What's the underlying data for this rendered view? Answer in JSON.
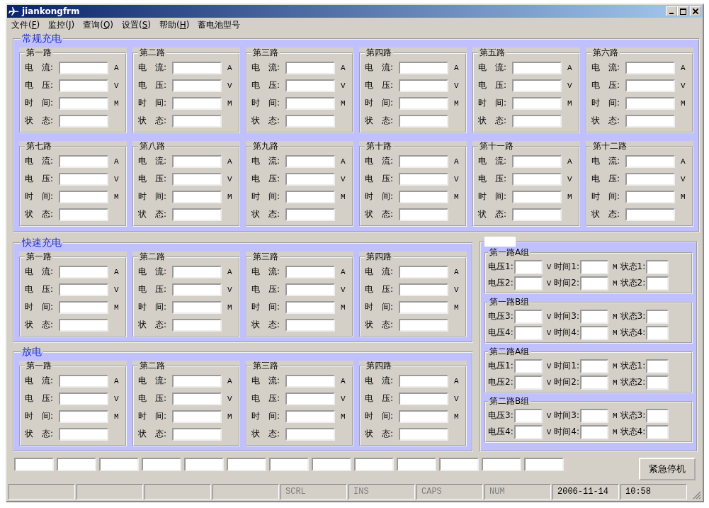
{
  "window": {
    "title": "jiankongfrm"
  },
  "menu": [
    {
      "before": "文件(",
      "key": "F",
      "after": ")"
    },
    {
      "before": "监控(",
      "key": "J",
      "after": ")"
    },
    {
      "before": "查询(",
      "key": "Q",
      "after": ")"
    },
    {
      "before": "设置(",
      "key": "S",
      "after": ")"
    },
    {
      "before": "帮助(",
      "key": "H",
      "after": ")"
    },
    {
      "before": "蓄电池型号"
    }
  ],
  "sections": [
    {
      "title": "常规充电",
      "channels": [
        {
          "name": "第一路",
          "rows": [
            {
              "label": "电　流:",
              "unit": "A"
            },
            {
              "label": "电　压:",
              "unit": "V"
            },
            {
              "label": "时　间:",
              "unit": "M"
            },
            {
              "label": "状　态:"
            }
          ]
        },
        {
          "name": "第二路",
          "rows": [
            {
              "label": "电　流:",
              "unit": "A"
            },
            {
              "label": "电　压:",
              "unit": "V"
            },
            {
              "label": "时　间:",
              "unit": "M"
            },
            {
              "label": "状　态:"
            }
          ]
        },
        {
          "name": "第三路",
          "rows": [
            {
              "label": "电　流:",
              "unit": "A"
            },
            {
              "label": "电　压:",
              "unit": "V"
            },
            {
              "label": "时　间:",
              "unit": "M"
            },
            {
              "label": "状　态:"
            }
          ]
        },
        {
          "name": "第四路",
          "rows": [
            {
              "label": "电　流:",
              "unit": "A"
            },
            {
              "label": "电　压:",
              "unit": "V"
            },
            {
              "label": "时　间:",
              "unit": "M"
            },
            {
              "label": "状　态:"
            }
          ]
        },
        {
          "name": "第五路",
          "rows": [
            {
              "label": "电　流:",
              "unit": "A"
            },
            {
              "label": "电　压:",
              "unit": "V"
            },
            {
              "label": "时　间:",
              "unit": "M"
            },
            {
              "label": "状　态:"
            }
          ]
        },
        {
          "name": "第六路",
          "rows": [
            {
              "label": "电　流:",
              "unit": "A"
            },
            {
              "label": "电　压:",
              "unit": "V"
            },
            {
              "label": "时　间:",
              "unit": "M"
            },
            {
              "label": "状　态:"
            }
          ]
        },
        {
          "name": "第七路",
          "rows": [
            {
              "label": "电　流:",
              "unit": "A"
            },
            {
              "label": "电　压:",
              "unit": "V"
            },
            {
              "label": "时　间:",
              "unit": "M"
            },
            {
              "label": "状　态:"
            }
          ]
        },
        {
          "name": "第八路",
          "rows": [
            {
              "label": "电　流:",
              "unit": "A"
            },
            {
              "label": "电　压:",
              "unit": "V"
            },
            {
              "label": "时　间:",
              "unit": "M"
            },
            {
              "label": "状　态:"
            }
          ]
        },
        {
          "name": "第九路",
          "rows": [
            {
              "label": "电　流:",
              "unit": "A"
            },
            {
              "label": "电　压:",
              "unit": "V"
            },
            {
              "label": "时　间:",
              "unit": "M"
            },
            {
              "label": "状　态:"
            }
          ]
        },
        {
          "name": "第十路",
          "rows": [
            {
              "label": "电　流:",
              "unit": "A"
            },
            {
              "label": "电　压:",
              "unit": "V"
            },
            {
              "label": "时　间:",
              "unit": "M"
            },
            {
              "label": "状　态:"
            }
          ]
        },
        {
          "name": "第十一路",
          "rows": [
            {
              "label": "电　流:",
              "unit": "A"
            },
            {
              "label": "电　压:",
              "unit": "V"
            },
            {
              "label": "时　间:",
              "unit": "M"
            },
            {
              "label": "状　态:"
            }
          ]
        },
        {
          "name": "第十二路",
          "rows": [
            {
              "label": "电　流:",
              "unit": "A"
            },
            {
              "label": "电　压:",
              "unit": "V"
            },
            {
              "label": "时　间:",
              "unit": "M"
            },
            {
              "label": "状　态:"
            }
          ]
        }
      ]
    },
    {
      "title": "快速充电",
      "channels": [
        {
          "name": "第一路",
          "rows": [
            {
              "label": "电　流:",
              "unit": "A"
            },
            {
              "label": "电　压:",
              "unit": "V"
            },
            {
              "label": "时　间:",
              "unit": "M"
            },
            {
              "label": "状　态:"
            }
          ]
        },
        {
          "name": "第二路",
          "rows": [
            {
              "label": "电　流:",
              "unit": "A"
            },
            {
              "label": "电　压:",
              "unit": "V"
            },
            {
              "label": "时　间:",
              "unit": "M"
            },
            {
              "label": "状　态:"
            }
          ]
        },
        {
          "name": "第三路",
          "rows": [
            {
              "label": "电　流:",
              "unit": "A"
            },
            {
              "label": "电　压:",
              "unit": "V"
            },
            {
              "label": "时　间:",
              "unit": "M"
            },
            {
              "label": "状　态:"
            }
          ]
        },
        {
          "name": "第四路",
          "rows": [
            {
              "label": "电　流:",
              "unit": "A"
            },
            {
              "label": "电　压:",
              "unit": "V"
            },
            {
              "label": "时　间:",
              "unit": "M"
            },
            {
              "label": "状　态:"
            }
          ]
        }
      ]
    },
    {
      "title": "放电",
      "channels": [
        {
          "name": "第一路",
          "rows": [
            {
              "label": "电　流:",
              "unit": "A"
            },
            {
              "label": "电　压:",
              "unit": "V"
            },
            {
              "label": "时　间:",
              "unit": "M"
            },
            {
              "label": "状　态:"
            }
          ]
        },
        {
          "name": "第二路",
          "rows": [
            {
              "label": "电　流:",
              "unit": "A"
            },
            {
              "label": "电　压:",
              "unit": "V"
            },
            {
              "label": "时　间:",
              "unit": "M"
            },
            {
              "label": "状　态:"
            }
          ]
        },
        {
          "name": "第三路",
          "rows": [
            {
              "label": "电　流:",
              "unit": "A"
            },
            {
              "label": "电　压:",
              "unit": "V"
            },
            {
              "label": "时　间:",
              "unit": "M"
            },
            {
              "label": "状　态:"
            }
          ]
        },
        {
          "name": "第四路",
          "rows": [
            {
              "label": "电　流:",
              "unit": "A"
            },
            {
              "label": "电　压:",
              "unit": "V"
            },
            {
              "label": "时　间:",
              "unit": "M"
            },
            {
              "label": "状　态:"
            }
          ]
        }
      ]
    }
  ],
  "battery_groups": [
    {
      "name": "第一路A组",
      "rows": [
        {
          "fields": [
            {
              "label": "电压1:",
              "unit": "V"
            },
            {
              "label": "时间1:",
              "unit": "M"
            },
            {
              "label": "状态1:"
            }
          ]
        },
        {
          "fields": [
            {
              "label": "电压2:",
              "unit": "V"
            },
            {
              "label": "时间2:",
              "unit": "M"
            },
            {
              "label": "状态2:"
            }
          ]
        }
      ]
    },
    {
      "name": "第一路B组",
      "rows": [
        {
          "fields": [
            {
              "label": "电压3:",
              "unit": "V"
            },
            {
              "label": "时间3:",
              "unit": "M"
            },
            {
              "label": "状态3:"
            }
          ]
        },
        {
          "fields": [
            {
              "label": "电压4:",
              "unit": "V"
            },
            {
              "label": "时间4:",
              "unit": "M"
            },
            {
              "label": "状态4:"
            }
          ]
        }
      ]
    },
    {
      "name": "第二路A组",
      "rows": [
        {
          "fields": [
            {
              "label": "电压1:",
              "unit": "V"
            },
            {
              "label": "时间1:",
              "unit": "M"
            },
            {
              "label": "状态1:"
            }
          ]
        },
        {
          "fields": [
            {
              "label": "电压2:",
              "unit": "V"
            },
            {
              "label": "时间2:",
              "unit": "M"
            },
            {
              "label": "状态2:"
            }
          ]
        }
      ]
    },
    {
      "name": "第二路B组",
      "rows": [
        {
          "fields": [
            {
              "label": "电压3:",
              "unit": "V"
            },
            {
              "label": "时间3:",
              "unit": "M"
            },
            {
              "label": "状态3:"
            }
          ]
        },
        {
          "fields": [
            {
              "label": "电压4:",
              "unit": "V"
            },
            {
              "label": "时间4:",
              "unit": "M"
            },
            {
              "label": "状态4:"
            }
          ]
        }
      ]
    }
  ],
  "emergency_button": "紧急停机",
  "status_bar": [
    {
      "text": "SCRL",
      "disabled": true
    },
    {
      "text": "INS",
      "disabled": true
    },
    {
      "text": "CAPS",
      "disabled": true
    },
    {
      "text": "NUM",
      "disabled": true
    },
    {
      "text": "2006-11-14",
      "disabled": false
    },
    {
      "text": "10:58",
      "disabled": false
    }
  ]
}
